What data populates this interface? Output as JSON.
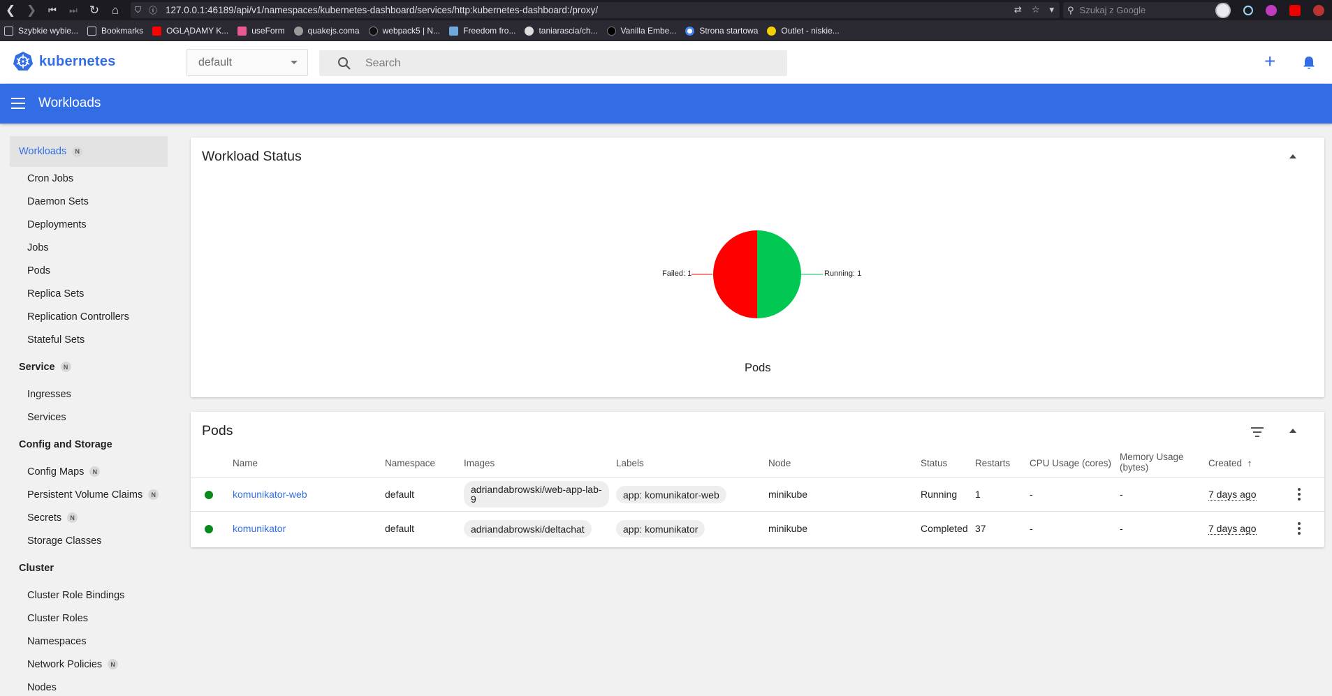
{
  "browser": {
    "url": "127.0.0.1:46189/api/v1/namespaces/kubernetes-dashboard/services/http:kubernetes-dashboard:/proxy/",
    "search_placeholder": "Szukaj z Google",
    "bookmarks": [
      {
        "label": "Szybkie wybie...",
        "icon_color": "#d0d0d0"
      },
      {
        "label": "Bookmarks",
        "icon_color": "#d0d0d0"
      },
      {
        "label": "OGLĄDAMY K...",
        "icon_color": "#ff0000"
      },
      {
        "label": "useForm",
        "icon_color": "#ec5990"
      },
      {
        "label": "quakejs.coma",
        "icon_color": "#9a9a9a"
      },
      {
        "label": "webpack5 | N...",
        "icon_color": "#111111"
      },
      {
        "label": "Freedom fro...",
        "icon_color": "#6fa8dc"
      },
      {
        "label": "taniarascia/ch...",
        "icon_color": "#dddddd"
      },
      {
        "label": "Vanilla Embe...",
        "icon_color": "#000000"
      },
      {
        "label": "Strona startowa",
        "icon_color": "#4285f4"
      },
      {
        "label": "Outlet - niskie...",
        "icon_color": "#f4d000"
      }
    ]
  },
  "header": {
    "brand": "kubernetes",
    "namespace": "default",
    "search_placeholder": "Search"
  },
  "toolbar": {
    "title": "Workloads"
  },
  "sidebar": {
    "badge": "N",
    "workloads": {
      "label": "Workloads",
      "items": [
        "Cron Jobs",
        "Daemon Sets",
        "Deployments",
        "Jobs",
        "Pods",
        "Replica Sets",
        "Replication Controllers",
        "Stateful Sets"
      ]
    },
    "service": {
      "label": "Service",
      "items": [
        "Ingresses",
        "Services"
      ]
    },
    "config": {
      "label": "Config and Storage",
      "items": [
        "Config Maps",
        "Persistent Volume Claims",
        "Secrets",
        "Storage Classes"
      ]
    },
    "cluster": {
      "label": "Cluster",
      "items": [
        "Cluster Role Bindings",
        "Cluster Roles",
        "Namespaces",
        "Network Policies",
        "Nodes"
      ]
    }
  },
  "workload_status": {
    "title": "Workload Status",
    "chart_data": {
      "type": "pie",
      "title": "Pods",
      "slices": [
        {
          "label": "Running",
          "value": 1,
          "color": "#00c853"
        },
        {
          "label": "Failed",
          "value": 1,
          "color": "#ff0000"
        }
      ],
      "label_running": "Running: 1",
      "label_failed": "Failed: 1"
    }
  },
  "pods": {
    "title": "Pods",
    "columns": {
      "name": "Name",
      "namespace": "Namespace",
      "images": "Images",
      "labels": "Labels",
      "node": "Node",
      "status": "Status",
      "restarts": "Restarts",
      "cpu": "CPU Usage (cores)",
      "memory_1": "Memory Usage",
      "memory_2": "(bytes)",
      "created": "Created"
    },
    "rows": [
      {
        "name": "komunikator-web",
        "namespace": "default",
        "image_1": "adriandabrowski/web-app-lab-",
        "image_2": "9",
        "label": "app: komunikator-web",
        "node": "minikube",
        "status": "Running",
        "restarts": "1",
        "cpu": "-",
        "memory": "-",
        "created": "7 days ago"
      },
      {
        "name": "komunikator",
        "namespace": "default",
        "image_1": "adriandabrowski/deltachat",
        "image_2": "",
        "label": "app: komunikator",
        "node": "minikube",
        "status": "Completed",
        "restarts": "37",
        "cpu": "-",
        "memory": "-",
        "created": "7 days ago"
      }
    ]
  }
}
